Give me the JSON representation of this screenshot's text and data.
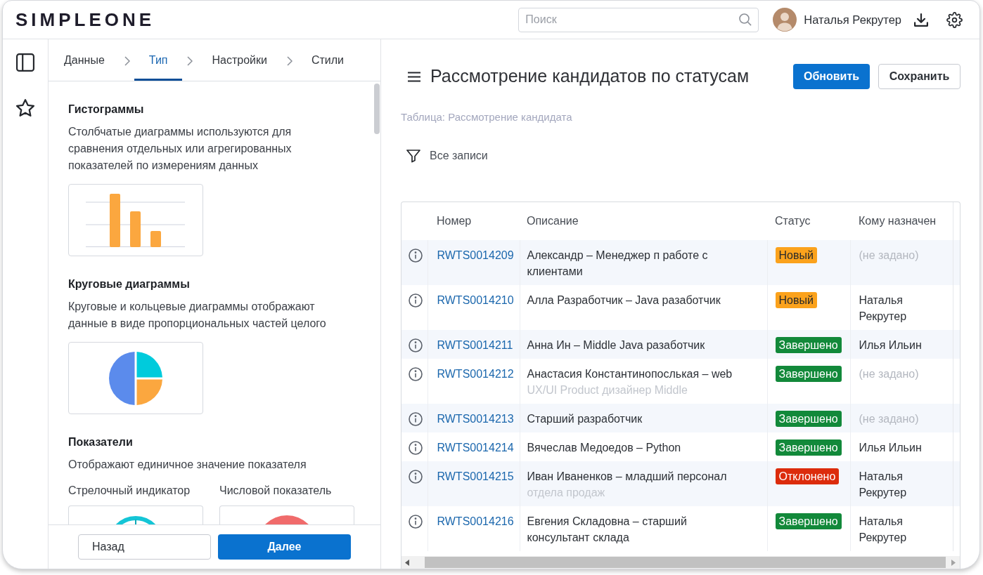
{
  "header": {
    "logo": "SIMPLEONE",
    "search": {
      "placeholder": "Поиск"
    },
    "user": {
      "name": "Наталья Рекрутер"
    }
  },
  "wizard": {
    "steps": [
      {
        "label": "Данные",
        "selected": false
      },
      {
        "label": "Тип",
        "selected": true
      },
      {
        "label": "Настройки",
        "selected": false
      },
      {
        "label": "Стили",
        "selected": false
      }
    ],
    "sections": [
      {
        "title": "Гистограммы",
        "description": "Столбчатые диаграммы используются для сравнения отдельных или агрегированных показателей по измерениям данных",
        "options": [
          {
            "kind": "bar"
          }
        ]
      },
      {
        "title": "Круговые диаграммы",
        "description": "Круговые и кольцевые диаграммы отображают данные в виде пропорциональных частей целого",
        "options": [
          {
            "kind": "pie"
          }
        ]
      },
      {
        "title": "Показатели",
        "description": "Отображают единичное значение показателя",
        "options": [
          {
            "kind": "gauge",
            "label": "Стрелочный индикатор"
          },
          {
            "kind": "number",
            "label": "Числовой показатель"
          }
        ]
      }
    ],
    "buttons": [
      {
        "label": "Назад",
        "kind": "secondary"
      },
      {
        "label": "Далее",
        "kind": "primary"
      }
    ]
  },
  "report": {
    "title": "Рассмотрение кандидатов по статусам",
    "buttons": [
      {
        "label": "Обновить",
        "kind": "primary"
      },
      {
        "label": "Сохранить",
        "kind": "secondary"
      }
    ],
    "source": "Таблица: Рассмотрение кандидата",
    "filter": "Все записи",
    "table": {
      "columns": [
        "Номер",
        "Описание",
        "Статус",
        "Кому назначен"
      ],
      "rows": [
        {
          "number": "RWTS0014209",
          "description": "Александр – Менеджер п работе с клиентами",
          "status": {
            "label": "Новый",
            "color": "#fba21c"
          },
          "assignee": "(не задано)",
          "unset": true
        },
        {
          "number": "RWTS0014210",
          "description": "Алла Разработчик – Java разаботчик",
          "status": {
            "label": "Новый",
            "color": "#fba21c"
          },
          "assignee": "Наталья Рекрутер",
          "unset": false
        },
        {
          "number": "RWTS0014211",
          "description": "Анна Ин – Middle Java разаботчик",
          "status": {
            "label": "Завершено",
            "color": "#12893a"
          },
          "assignee": "Илья Ильин",
          "unset": false
        },
        {
          "number": "RWTS0014212",
          "description": "Анастасия Константинопослькая – web",
          "description_overflow": "UX/UI Product дизайнер Middle",
          "status": {
            "label": "Завершено",
            "color": "#12893a"
          },
          "assignee": "(не задано)",
          "unset": true
        },
        {
          "number": "RWTS0014213",
          "description": "Старший разработчик",
          "status": {
            "label": "Завершено",
            "color": "#12893a"
          },
          "assignee": "(не задано)",
          "unset": true
        },
        {
          "number": "RWTS0014214",
          "description": "Вячеслав Медоедов – Python",
          "status": {
            "label": "Завершено",
            "color": "#12893a"
          },
          "assignee": "Илья Ильин",
          "unset": false
        },
        {
          "number": "RWTS0014215",
          "description": "Иван Иваненков – младший персонал",
          "description_overflow": "отдела продаж",
          "status": {
            "label": "Отклонено",
            "color": "#dc2c0c"
          },
          "assignee": "Наталья Рекрутер",
          "unset": false
        },
        {
          "number": "RWTS0014216",
          "description": "Евгения Складовна – старший консультант склада",
          "status": {
            "label": "Завершено",
            "color": "#12893a"
          },
          "assignee": "Наталья Рекрутер",
          "unset": false
        }
      ]
    }
  }
}
